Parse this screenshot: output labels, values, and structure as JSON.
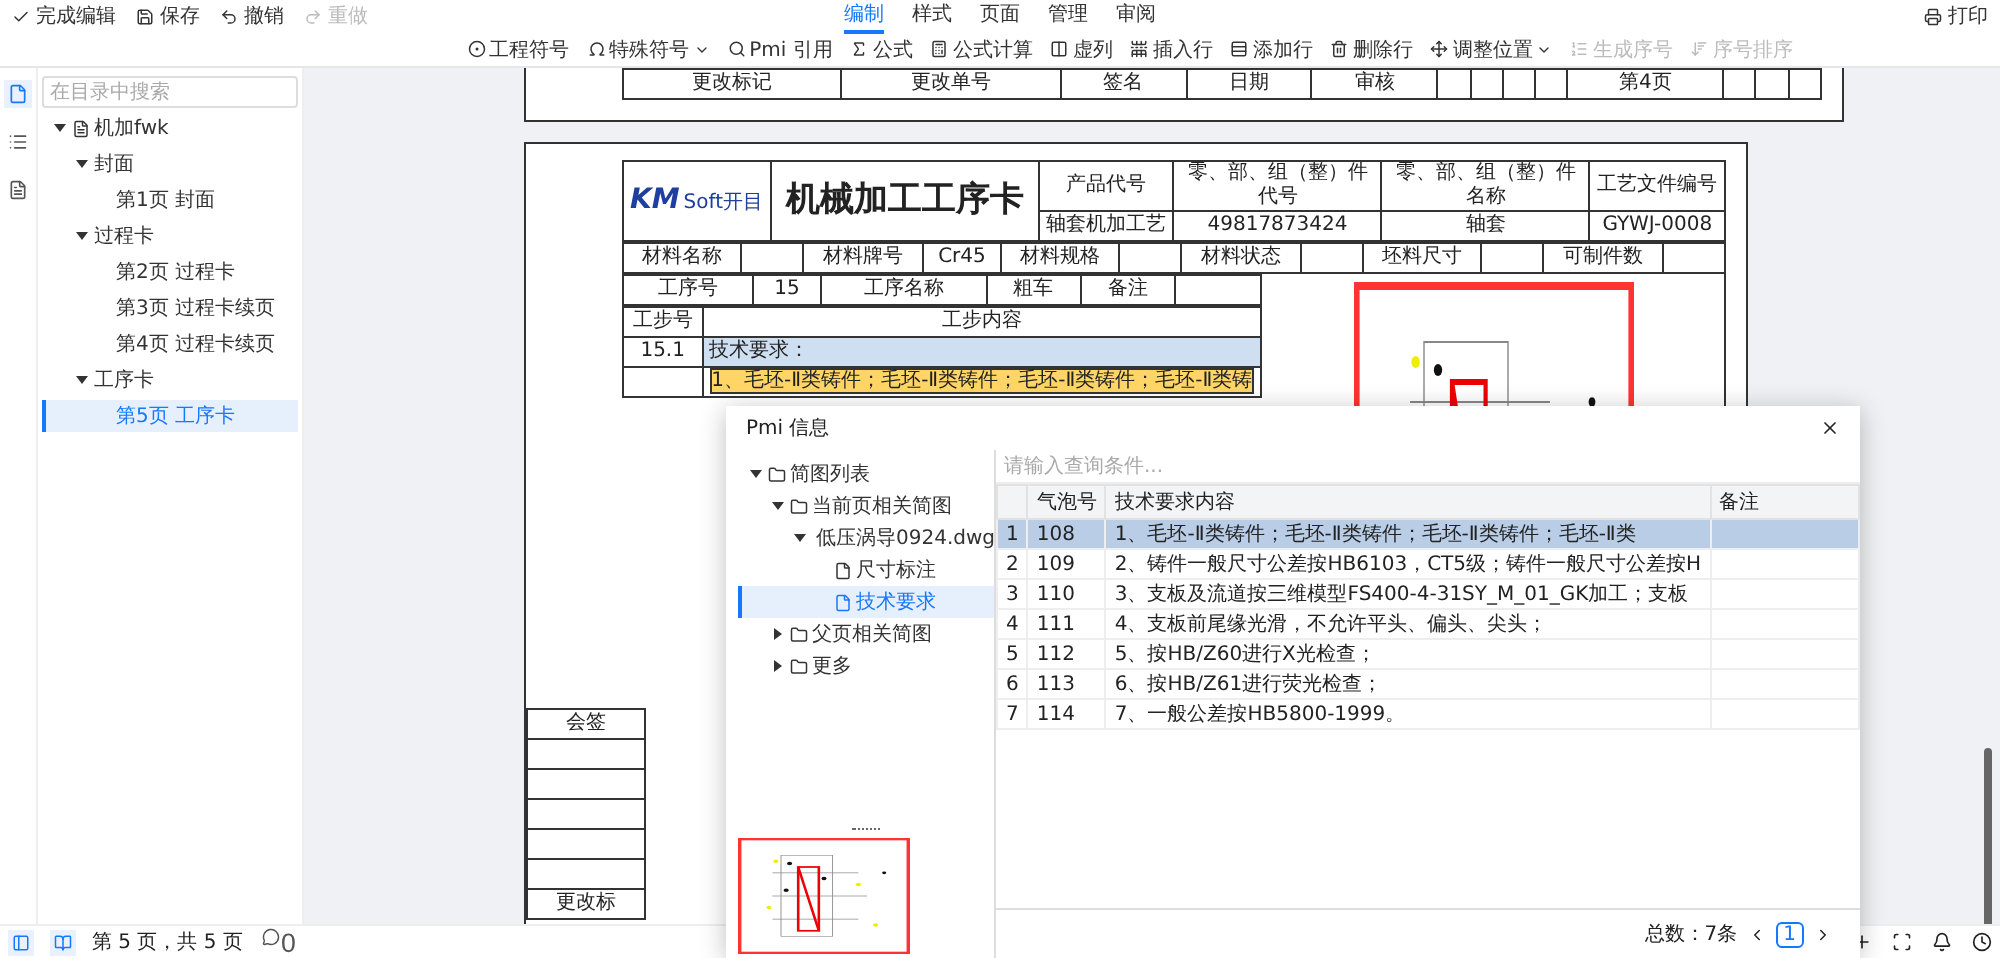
{
  "top_bar": {
    "actions": [
      {
        "label": "完成编辑",
        "disabled": false
      },
      {
        "label": "保存",
        "disabled": false
      },
      {
        "label": "撤销",
        "disabled": false
      },
      {
        "label": "重做",
        "disabled": true
      }
    ],
    "tabs": [
      {
        "label": "编制",
        "selected": true
      },
      {
        "label": "样式",
        "selected": false
      },
      {
        "label": "页面",
        "selected": false
      },
      {
        "label": "管理",
        "selected": false
      },
      {
        "label": "审阅",
        "selected": false
      }
    ],
    "print": "打印"
  },
  "toolbar": [
    {
      "label": "工程符号",
      "disabled": false,
      "dropdown": false
    },
    {
      "label": "特殊符号",
      "disabled": false,
      "dropdown": true
    },
    {
      "label": "Pmi 引用",
      "disabled": false,
      "dropdown": false
    },
    {
      "label": "公式",
      "disabled": false,
      "dropdown": false
    },
    {
      "label": "公式计算",
      "disabled": false,
      "dropdown": false
    },
    {
      "label": "虚列",
      "disabled": false,
      "dropdown": false
    },
    {
      "label": "插入行",
      "disabled": false,
      "dropdown": false
    },
    {
      "label": "添加行",
      "disabled": false,
      "dropdown": false
    },
    {
      "label": "删除行",
      "disabled": false,
      "dropdown": false
    },
    {
      "label": "调整位置",
      "disabled": false,
      "dropdown": true
    },
    {
      "label": "生成序号",
      "disabled": true,
      "dropdown": false
    },
    {
      "label": "序号排序",
      "disabled": true,
      "dropdown": false
    }
  ],
  "sidebar": {
    "search_placeholder": "在目录中搜索",
    "tree": [
      {
        "label": "机加fwk",
        "expanded": true,
        "selected": false,
        "children": [
          {
            "label": "封面",
            "expanded": true,
            "selected": false,
            "children": [
              {
                "label": "第1页 封面",
                "selected": false
              }
            ]
          },
          {
            "label": "过程卡",
            "expanded": true,
            "selected": false,
            "children": [
              {
                "label": "第2页 过程卡",
                "selected": false
              },
              {
                "label": "第3页 过程卡续页",
                "selected": false
              },
              {
                "label": "第4页 过程卡续页",
                "selected": false
              }
            ]
          },
          {
            "label": "工序卡",
            "expanded": true,
            "selected": false,
            "children": [
              {
                "label": "第5页 工序卡",
                "selected": true
              }
            ]
          }
        ]
      }
    ]
  },
  "document": {
    "prev_page": {
      "cells": [
        "更改标记",
        "更改单号",
        "签名",
        "日期",
        "审核"
      ],
      "page_label": "第4页"
    },
    "card": {
      "logo_mark": "KM",
      "logo_text": "Soft开目",
      "title": "机械加工工序卡",
      "header_fields": [
        {
          "label": "产品代号",
          "value": "轴套机加工艺"
        },
        {
          "label": "零、部、组（整）件代号",
          "value": "49817873424"
        },
        {
          "label": "零、部、组（整）件名称",
          "value": "轴套"
        },
        {
          "label": "工艺文件编号",
          "value": "GYWJ-0008"
        }
      ],
      "material_row": [
        {
          "label": "材料名称"
        },
        {
          "label": "材料牌号",
          "value": "Cr45"
        },
        {
          "label": "材料规格"
        },
        {
          "label": "材料状态"
        },
        {
          "label": "坯料尺寸"
        },
        {
          "label": "可制件数"
        }
      ],
      "process_row": [
        {
          "label": "工序号",
          "value": "15"
        },
        {
          "label": "工序名称",
          "value": "粗车"
        },
        {
          "label": "备注"
        }
      ],
      "step_headers": [
        "工步号",
        "工步内容"
      ],
      "steps": [
        {
          "number": "15.1",
          "content": "技术要求：",
          "selected": true,
          "highlighted": false
        },
        {
          "content": "1、毛坯-Ⅱ类铸件；毛坯-Ⅱ类铸件；毛坯-Ⅱ类铸件；毛坯-Ⅱ类铸",
          "selected": false,
          "highlighted": true
        }
      ],
      "countersign": "会签",
      "change_mark": "更改标"
    }
  },
  "dialog": {
    "title": "Pmi 信息",
    "tree": [
      {
        "label": "简图列表",
        "expanded": true,
        "selected": false,
        "children": [
          {
            "label": "当前页相关简图",
            "expanded": true,
            "selected": false,
            "children": [
              {
                "label": "低压涡导0924.dwg",
                "expanded": true,
                "selected": false,
                "children": [
                  {
                    "label": "尺寸标注",
                    "selected": false
                  },
                  {
                    "label": "技术要求",
                    "selected": true
                  }
                ]
              }
            ]
          },
          {
            "label": "父页相关简图",
            "expanded": false,
            "selected": false
          },
          {
            "label": "更多",
            "expanded": false,
            "selected": false
          }
        ]
      }
    ],
    "search_placeholder": "请输入查询条件...",
    "columns": [
      "气泡号",
      "技术要求内容",
      "备注"
    ],
    "rows": [
      {
        "index": "1",
        "bubble": "108",
        "content": "1、毛坯-Ⅱ类铸件；毛坯-Ⅱ类铸件；毛坯-Ⅱ类铸件；毛坯-Ⅱ类",
        "selected": true
      },
      {
        "index": "2",
        "bubble": "109",
        "content": "2、铸件一般尺寸公差按HB6103，CT5级；铸件一般尺寸公差按H",
        "selected": false
      },
      {
        "index": "3",
        "bubble": "110",
        "content": "3、支板及流道按三维模型FS400-4-31SY_M_01_GK加工；支板",
        "selected": false
      },
      {
        "index": "4",
        "bubble": "111",
        "content": "4、支板前尾缘光滑，不允许平头、偏头、尖头；",
        "selected": false
      },
      {
        "index": "5",
        "bubble": "112",
        "content": "5、按HB/Z60进行X光检查；",
        "selected": false
      },
      {
        "index": "6",
        "bubble": "113",
        "content": "6、按HB/Z61进行荧光检查；",
        "selected": false
      },
      {
        "index": "7",
        "bubble": "114",
        "content": "7、一般公差按HB5800-1999。",
        "selected": false
      }
    ],
    "total": "总数：7条",
    "pages": [
      {
        "label": "1",
        "selected": true
      }
    ]
  },
  "status_bar": {
    "page_info": "第 5 页，共 5 页",
    "comments": "0"
  }
}
